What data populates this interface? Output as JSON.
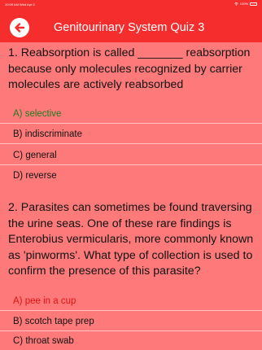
{
  "status_bar": {
    "left": "10:09 AM  Wed Apr 2",
    "battery": "100%"
  },
  "header": {
    "title": "Genitourinary System Quiz 3"
  },
  "questions": [
    {
      "text": "1. Reabsorption is called _______ reabsorption because only molecules recognized by carrier molecules are actively reabsorbed",
      "options": [
        "A) selective",
        "B) indiscriminate",
        "C) general",
        "D) reverse"
      ]
    },
    {
      "text": "2. Parasites can sometimes be found traversing the urine seas. One of these rare findings is Enterobius vermicularis, more commonly known as 'pinworms'. What type of collection is used to confirm the presence of this parasite?",
      "options": [
        "A) pee in a cup",
        "B) scotch tape prep",
        "C) throat swab"
      ]
    }
  ],
  "colors": {
    "header_bg": "#f52d2d",
    "page_bg": "#fe7a7a",
    "correct": "#1d7a1d",
    "wrong": "#e01010"
  },
  "icons": {
    "back": "arrow-left-icon"
  }
}
